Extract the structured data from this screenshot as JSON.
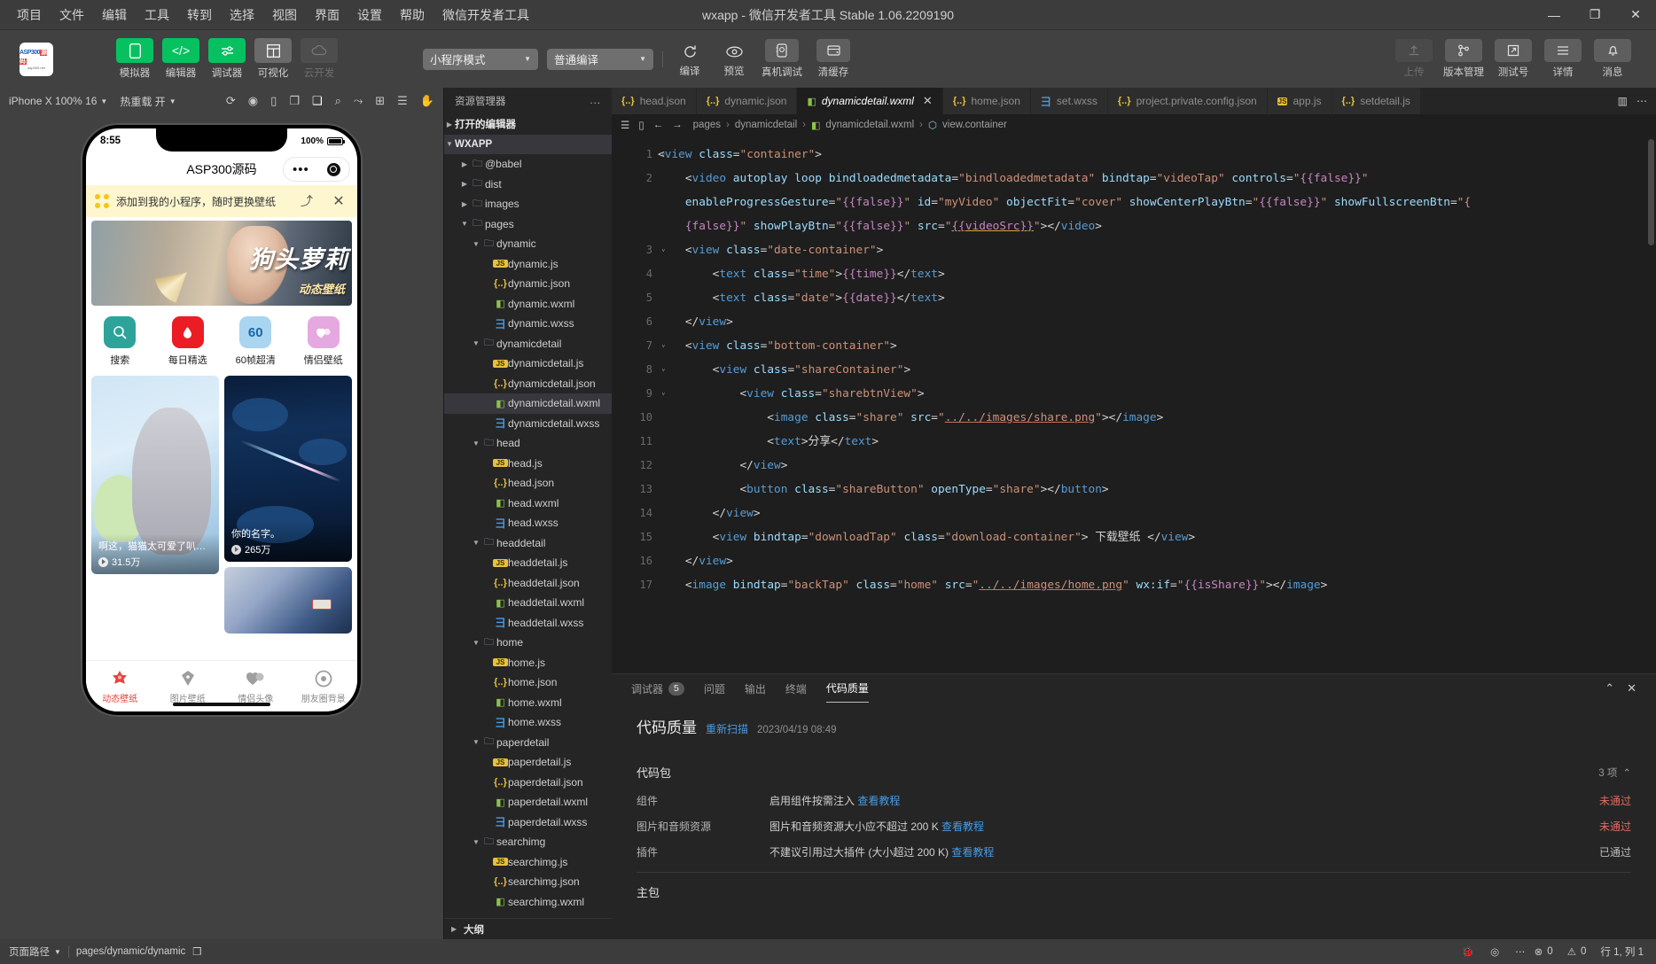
{
  "window": {
    "title": "wxapp - 微信开发者工具 Stable 1.06.2209190",
    "menu": [
      "项目",
      "文件",
      "编辑",
      "工具",
      "转到",
      "选择",
      "视图",
      "界面",
      "设置",
      "帮助",
      "微信开发者工具"
    ],
    "controls": {
      "minimize": "—",
      "maximize": "❐",
      "close": "✕"
    }
  },
  "toolbar": {
    "logo": {
      "line1": "ASP300",
      "badge": "源码",
      "line2": "asp300.net"
    },
    "modes": [
      {
        "label": "模拟器",
        "icon": "phone-icon",
        "state": "green"
      },
      {
        "label": "编辑器",
        "icon": "code-icon",
        "state": "green"
      },
      {
        "label": "调试器",
        "icon": "debug-icon",
        "state": "green"
      },
      {
        "label": "可视化",
        "icon": "layout-icon",
        "state": "grey"
      },
      {
        "label": "云开发",
        "icon": "cloud-icon",
        "state": "dim"
      }
    ],
    "mode_select": "小程序模式",
    "compile_select": "普通编译",
    "actions": [
      {
        "label": "编译",
        "icon": "refresh-icon"
      },
      {
        "label": "预览",
        "icon": "eye-icon"
      },
      {
        "label": "真机调试",
        "icon": "device-debug-icon"
      },
      {
        "label": "清缓存",
        "icon": "clear-cache-icon"
      }
    ],
    "right_actions": [
      {
        "label": "上传",
        "icon": "upload-icon",
        "disabled": true
      },
      {
        "label": "版本管理",
        "icon": "branch-icon",
        "disabled": false
      },
      {
        "label": "测试号",
        "icon": "external-link-icon",
        "disabled": false
      },
      {
        "label": "详情",
        "icon": "menu-icon",
        "disabled": false
      },
      {
        "label": "消息",
        "icon": "bell-icon",
        "disabled": false
      }
    ]
  },
  "simulator": {
    "device": "iPhone X 100% 16",
    "hot_reload": "热重载 开",
    "toolbar_icons": [
      "rotate-icon",
      "record-icon",
      "screen-icon",
      "copy-icon",
      "inspect-icon",
      "search-icon",
      "share-icon",
      "split-icon",
      "list-icon",
      "hand-icon"
    ],
    "phone": {
      "status_time": "8:55",
      "battery_percent": "100%",
      "nav_title": "ASP300源码",
      "banner_text": "添加到我的小程序，随时更换壁纸",
      "banner_close": "✕",
      "hero": {
        "title": "狗头萝莉",
        "subtitle": "动态壁纸"
      },
      "categories": [
        {
          "label": "搜索",
          "icon": "search-icon",
          "color": "#2ea39a"
        },
        {
          "label": "每日精选",
          "icon": "drop-icon",
          "color": "#ec1c24"
        },
        {
          "label": "60帧超清",
          "icon": "60",
          "color": "#a9d5f0"
        },
        {
          "label": "情侣壁纸",
          "icon": "couple-icon",
          "color": "#e6a8e0"
        }
      ],
      "cards": [
        {
          "title": "啊这，猫猫太可爱了叭修...",
          "plays": "31.5万",
          "kind": "cat"
        },
        {
          "title": "你的名字。",
          "plays": "265万",
          "kind": "night"
        },
        {
          "title": "",
          "plays": "",
          "kind": "blue"
        }
      ],
      "tabs": [
        {
          "label": "动态壁纸",
          "icon": "flower-icon",
          "active": true
        },
        {
          "label": "图片壁纸",
          "icon": "umbrella-icon",
          "active": false
        },
        {
          "label": "情侣头像",
          "icon": "hearts-icon",
          "active": false
        },
        {
          "label": "朋友圈背景",
          "icon": "moments-icon",
          "active": false
        }
      ]
    }
  },
  "explorer": {
    "title": "资源管理器",
    "more": "...",
    "open_editors": "打开的编辑器",
    "project": "WXAPP",
    "outline": "大纲",
    "tree": [
      {
        "name": "@babel",
        "type": "folder",
        "depth": 1,
        "expanded": false,
        "icon": "folder-icon"
      },
      {
        "name": "dist",
        "type": "folder",
        "depth": 1,
        "expanded": false,
        "icon": "folder-dist-icon"
      },
      {
        "name": "images",
        "type": "folder",
        "depth": 1,
        "expanded": false,
        "icon": "folder-images-icon"
      },
      {
        "name": "pages",
        "type": "folder",
        "depth": 1,
        "expanded": true,
        "icon": "folder-pages-icon"
      },
      {
        "name": "dynamic",
        "type": "folder",
        "depth": 2,
        "expanded": true,
        "icon": "folder-icon"
      },
      {
        "name": "dynamic.js",
        "type": "js",
        "depth": 3
      },
      {
        "name": "dynamic.json",
        "type": "json",
        "depth": 3
      },
      {
        "name": "dynamic.wxml",
        "type": "wxml",
        "depth": 3
      },
      {
        "name": "dynamic.wxss",
        "type": "wxss",
        "depth": 3
      },
      {
        "name": "dynamicdetail",
        "type": "folder",
        "depth": 2,
        "expanded": true,
        "icon": "folder-icon"
      },
      {
        "name": "dynamicdetail.js",
        "type": "js",
        "depth": 3
      },
      {
        "name": "dynamicdetail.json",
        "type": "json",
        "depth": 3
      },
      {
        "name": "dynamicdetail.wxml",
        "type": "wxml",
        "depth": 3,
        "selected": true
      },
      {
        "name": "dynamicdetail.wxss",
        "type": "wxss",
        "depth": 3
      },
      {
        "name": "head",
        "type": "folder",
        "depth": 2,
        "expanded": true,
        "icon": "folder-icon"
      },
      {
        "name": "head.js",
        "type": "js",
        "depth": 3
      },
      {
        "name": "head.json",
        "type": "json",
        "depth": 3
      },
      {
        "name": "head.wxml",
        "type": "wxml",
        "depth": 3
      },
      {
        "name": "head.wxss",
        "type": "wxss",
        "depth": 3
      },
      {
        "name": "headdetail",
        "type": "folder",
        "depth": 2,
        "expanded": true,
        "icon": "folder-icon"
      },
      {
        "name": "headdetail.js",
        "type": "js",
        "depth": 3
      },
      {
        "name": "headdetail.json",
        "type": "json",
        "depth": 3
      },
      {
        "name": "headdetail.wxml",
        "type": "wxml",
        "depth": 3
      },
      {
        "name": "headdetail.wxss",
        "type": "wxss",
        "depth": 3
      },
      {
        "name": "home",
        "type": "folder",
        "depth": 2,
        "expanded": true,
        "icon": "folder-icon"
      },
      {
        "name": "home.js",
        "type": "js",
        "depth": 3
      },
      {
        "name": "home.json",
        "type": "json",
        "depth": 3
      },
      {
        "name": "home.wxml",
        "type": "wxml",
        "depth": 3
      },
      {
        "name": "home.wxss",
        "type": "wxss",
        "depth": 3
      },
      {
        "name": "paperdetail",
        "type": "folder",
        "depth": 2,
        "expanded": true,
        "icon": "folder-icon"
      },
      {
        "name": "paperdetail.js",
        "type": "js",
        "depth": 3
      },
      {
        "name": "paperdetail.json",
        "type": "json",
        "depth": 3
      },
      {
        "name": "paperdetail.wxml",
        "type": "wxml",
        "depth": 3
      },
      {
        "name": "paperdetail.wxss",
        "type": "wxss",
        "depth": 3
      },
      {
        "name": "searchimg",
        "type": "folder",
        "depth": 2,
        "expanded": true,
        "icon": "folder-icon"
      },
      {
        "name": "searchimg.js",
        "type": "js",
        "depth": 3
      },
      {
        "name": "searchimg.json",
        "type": "json",
        "depth": 3
      },
      {
        "name": "searchimg.wxml",
        "type": "wxml",
        "depth": 3
      }
    ]
  },
  "editor": {
    "tabs": [
      {
        "label": "head.json",
        "type": "json",
        "active": false
      },
      {
        "label": "dynamic.json",
        "type": "json",
        "active": false
      },
      {
        "label": "dynamicdetail.wxml",
        "type": "wxml",
        "active": true,
        "close": "✕"
      },
      {
        "label": "home.json",
        "type": "json",
        "active": false
      },
      {
        "label": "set.wxss",
        "type": "wxss",
        "active": false
      },
      {
        "label": "project.private.config.json",
        "type": "json",
        "active": false
      },
      {
        "label": "app.js",
        "type": "js",
        "active": false
      },
      {
        "label": "setdetail.js",
        "type": "json",
        "active": false
      }
    ],
    "tabs_right": {
      "split": "split-editor-icon",
      "more": "⋯"
    },
    "breadcrumb": [
      "pages",
      "dynamicdetail",
      "dynamicdetail.wxml",
      "view.container"
    ],
    "breadcrumb_icons": [
      "outline-icon",
      "square-icon",
      "back-arrow-icon",
      "forward-arrow-icon"
    ],
    "lines": [
      {
        "n": "1",
        "fold": "v"
      },
      {
        "n": "2",
        "fold": ""
      },
      {
        "n": "",
        "fold": ""
      },
      {
        "n": "",
        "fold": ""
      },
      {
        "n": "3",
        "fold": "v"
      },
      {
        "n": "4",
        "fold": ""
      },
      {
        "n": "5",
        "fold": ""
      },
      {
        "n": "6",
        "fold": ""
      },
      {
        "n": "7",
        "fold": "v"
      },
      {
        "n": "8",
        "fold": "v"
      },
      {
        "n": "9",
        "fold": "v"
      },
      {
        "n": "10",
        "fold": ""
      },
      {
        "n": "11",
        "fold": ""
      },
      {
        "n": "12",
        "fold": ""
      },
      {
        "n": "13",
        "fold": ""
      },
      {
        "n": "14",
        "fold": ""
      },
      {
        "n": "15",
        "fold": ""
      },
      {
        "n": "16",
        "fold": ""
      },
      {
        "n": "17",
        "fold": ""
      }
    ]
  },
  "panel": {
    "tabs": [
      {
        "label": "调试器",
        "badge": "5",
        "active": false
      },
      {
        "label": "问题",
        "badge": "",
        "active": false
      },
      {
        "label": "输出",
        "badge": "",
        "active": false
      },
      {
        "label": "终端",
        "badge": "",
        "active": false
      },
      {
        "label": "代码质量",
        "badge": "",
        "active": true
      }
    ],
    "actions": {
      "collapse": "⌃",
      "close": "✕"
    },
    "quality": {
      "heading": "代码质量",
      "rescan": "重新扫描",
      "timestamp": "2023/04/19 08:49",
      "sections": [
        {
          "name": "代码包",
          "count": "3 项",
          "chevron": "⌃",
          "rows": [
            {
              "name": "组件",
              "desc": "启用组件按需注入",
              "link": "查看教程",
              "status": "未通过",
              "pass": false
            },
            {
              "name": "图片和音频资源",
              "desc": "图片和音频资源大小应不超过 200 K",
              "link": "查看教程",
              "status": "未通过",
              "pass": false
            },
            {
              "name": "插件",
              "desc": "不建议引用过大插件 (大小超过 200 K)",
              "link": "查看教程",
              "status": "已通过",
              "pass": true
            }
          ]
        },
        {
          "name": "主包",
          "count": "",
          "chevron": "",
          "rows": []
        }
      ]
    }
  },
  "status": {
    "page_path_label": "页面路径",
    "page_path": "pages/dynamic/dynamic",
    "copy_icon": "copy-icon",
    "sim_icons": [
      "bug-icon",
      "eye-icon",
      "more-icon"
    ],
    "errors": "0",
    "warnings": "0",
    "cursor": "行 1, 列 1"
  },
  "colors": {
    "accent_green": "#07c160",
    "link_blue": "#4a9ae1",
    "fail_red": "#e06c5f",
    "tab_active_red": "#e64340"
  }
}
